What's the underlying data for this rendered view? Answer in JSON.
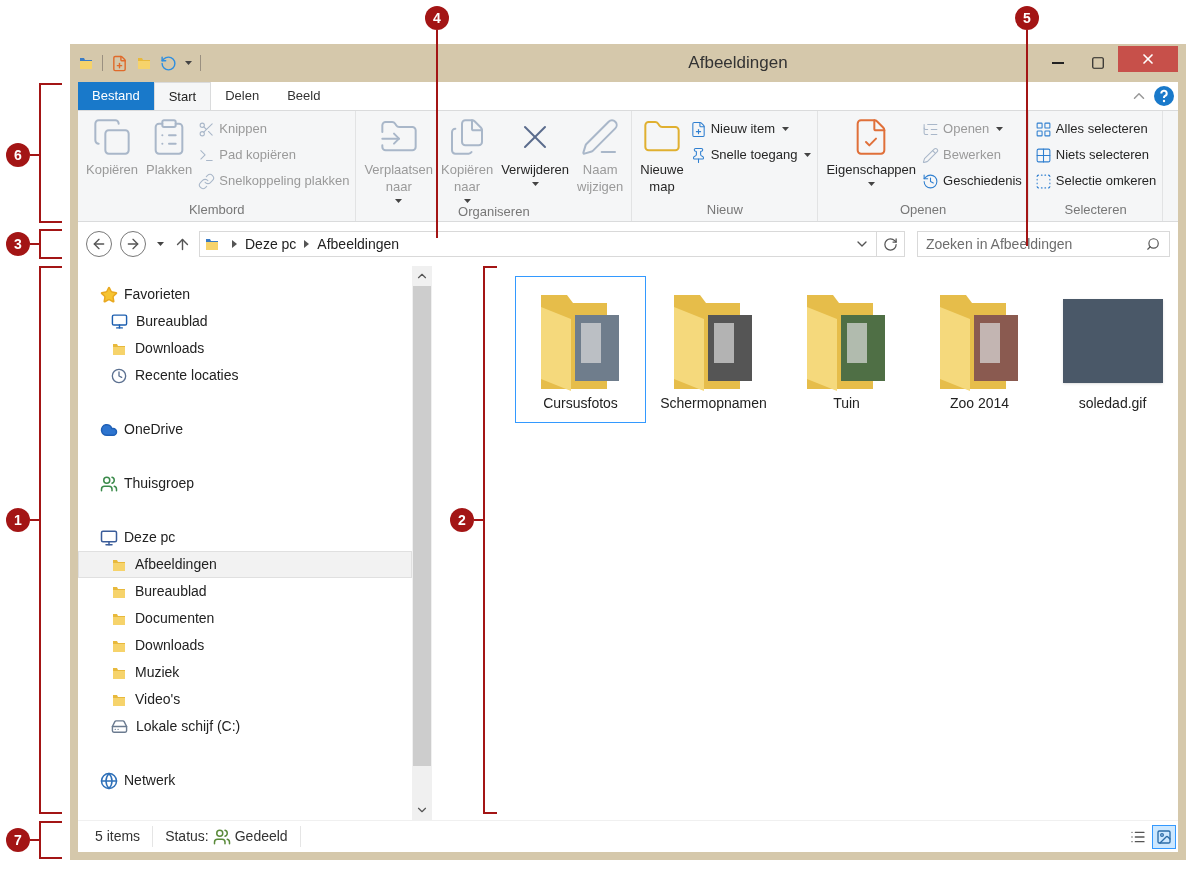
{
  "window": {
    "title": "Afbeeldingen"
  },
  "ribbon": {
    "tabs": [
      {
        "label": "Bestand",
        "kind": "file",
        "selected": false
      },
      {
        "label": "Start",
        "kind": "tab",
        "selected": true
      },
      {
        "label": "Delen",
        "kind": "tab",
        "selected": false
      },
      {
        "label": "Beeld",
        "kind": "tab",
        "selected": false
      }
    ],
    "groups": [
      {
        "label": "Klembord",
        "items": [
          {
            "label": "Kopiëren",
            "kind": "large",
            "disabled": true,
            "dropdown": false
          },
          {
            "label": "Plakken",
            "kind": "large",
            "disabled": true,
            "dropdown": false
          },
          {
            "label": "Knippen",
            "kind": "small",
            "disabled": true,
            "dropdown": false
          },
          {
            "label": "Pad kopiëren",
            "kind": "small",
            "disabled": true,
            "dropdown": false
          },
          {
            "label": "Snelkoppeling plakken",
            "kind": "small",
            "disabled": true,
            "dropdown": false
          }
        ]
      },
      {
        "label": "Organiseren",
        "items": [
          {
            "label": "Verplaatsen\nnaar",
            "kind": "large",
            "disabled": true,
            "dropdown": true
          },
          {
            "label": "Kopiëren\nnaar",
            "kind": "large",
            "disabled": true,
            "dropdown": true
          },
          {
            "label": "Verwijderen",
            "kind": "large",
            "disabled": false,
            "dropdown": true
          },
          {
            "label": "Naam\nwijzigen",
            "kind": "large",
            "disabled": true,
            "dropdown": false
          }
        ]
      },
      {
        "label": "Nieuw",
        "items": [
          {
            "label": "Nieuwe\nmap",
            "kind": "large",
            "disabled": false,
            "dropdown": false
          },
          {
            "label": "Nieuw item",
            "kind": "small",
            "disabled": false,
            "dropdown": true
          },
          {
            "label": "Snelle toegang",
            "kind": "small",
            "disabled": false,
            "dropdown": true
          }
        ]
      },
      {
        "label": "Openen",
        "items": [
          {
            "label": "Eigenschappen",
            "kind": "large",
            "disabled": false,
            "dropdown": true
          },
          {
            "label": "Openen",
            "kind": "small",
            "disabled": true,
            "dropdown": true
          },
          {
            "label": "Bewerken",
            "kind": "small",
            "disabled": true,
            "dropdown": false
          },
          {
            "label": "Geschiedenis",
            "kind": "small",
            "disabled": false,
            "dropdown": false
          }
        ]
      },
      {
        "label": "Selecteren",
        "items": [
          {
            "label": "Alles selecteren",
            "kind": "small",
            "disabled": false,
            "dropdown": false
          },
          {
            "label": "Niets selecteren",
            "kind": "small",
            "disabled": false,
            "dropdown": false
          },
          {
            "label": "Selectie omkeren",
            "kind": "small",
            "disabled": false,
            "dropdown": false
          }
        ]
      }
    ]
  },
  "address_bar": {
    "path": [
      "Deze pc",
      "Afbeeldingen"
    ],
    "search": {
      "placeholder": "Zoeken in Afbeeldingen"
    }
  },
  "navigation_pane": {
    "sections": [
      {
        "label": "Favorieten",
        "selected": false,
        "children": [
          {
            "label": "Bureaublad",
            "selected": false
          },
          {
            "label": "Downloads",
            "selected": false
          },
          {
            "label": "Recente locaties",
            "selected": false
          }
        ]
      },
      {
        "label": "OneDrive",
        "selected": false
      },
      {
        "label": "Thuisgroep",
        "selected": false
      },
      {
        "label": "Deze pc",
        "selected": false,
        "children": [
          {
            "label": "Afbeeldingen",
            "selected": true
          },
          {
            "label": "Bureaublad",
            "selected": false
          },
          {
            "label": "Documenten",
            "selected": false
          },
          {
            "label": "Downloads",
            "selected": false
          },
          {
            "label": "Muziek",
            "selected": false
          },
          {
            "label": "Video's",
            "selected": false
          },
          {
            "label": "Lokale schijf (C:)",
            "selected": false
          }
        ]
      },
      {
        "label": "Netwerk",
        "selected": false
      }
    ]
  },
  "files": [
    {
      "name": "Cursusfotos",
      "kind": "folder",
      "selected": true
    },
    {
      "name": "Schermopnamen",
      "kind": "folder",
      "selected": false
    },
    {
      "name": "Tuin",
      "kind": "folder",
      "selected": false
    },
    {
      "name": "Zoo 2014",
      "kind": "folder",
      "selected": false
    },
    {
      "name": "soledad.gif",
      "kind": "image",
      "selected": false
    }
  ],
  "status_bar": {
    "count": "5 items",
    "status_label": "Status:",
    "status_value": "Gedeeld",
    "views": [
      {
        "kind": "details",
        "selected": false
      },
      {
        "kind": "thumbnails",
        "selected": true
      }
    ]
  },
  "callouts": [
    "1",
    "2",
    "3",
    "4",
    "5",
    "6",
    "7"
  ]
}
